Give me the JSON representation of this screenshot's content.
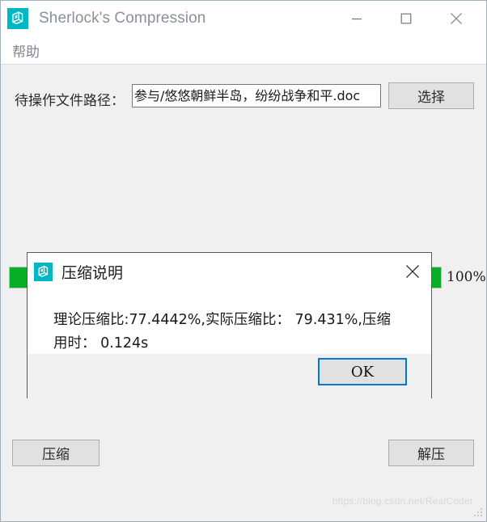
{
  "window": {
    "title": "Sherlock's Compression",
    "icon": "app-logo-icon",
    "controls": {
      "minimize": "—",
      "maximize": "□",
      "close": "✕"
    }
  },
  "menu": {
    "items": [
      {
        "label": "帮助"
      }
    ]
  },
  "file_path": {
    "label": "待操作文件路径：",
    "value": "参与/悠悠朝鲜半岛，纷纷战争和平.doc",
    "placeholder": "",
    "select_button_label": "选择"
  },
  "progress": {
    "percent": 100,
    "percent_label": "100%",
    "fill_color": "#08ae28"
  },
  "actions": {
    "compress_label": "压缩",
    "decompress_label": "解压"
  },
  "dialog": {
    "title": "压缩说明",
    "icon": "app-logo-icon",
    "close_glyph": "✕",
    "message": "理论压缩比:77.4442%,实际压缩比： 79.431%,压缩用时： 0.124s",
    "ok_label": "OK",
    "theoretical_ratio": "77.4442%",
    "actual_ratio": "79.431%",
    "elapsed_time": "0.124s"
  },
  "watermark": {
    "text": "https://blog.csdn.net/RealCoder"
  },
  "colors": {
    "accent": "#00b8c4",
    "focus": "#0078d7",
    "progress": "#08ae28",
    "title_text": "#8a9099",
    "client_bg": "#f0f0f0"
  }
}
